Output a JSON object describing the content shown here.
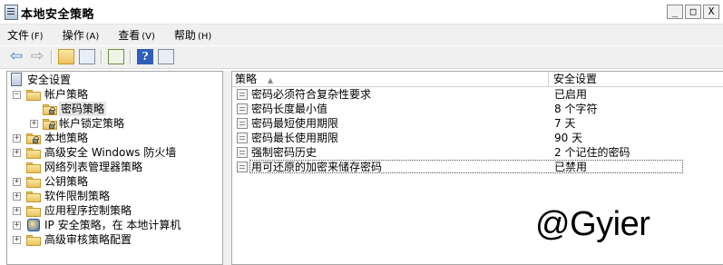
{
  "window": {
    "title": "本地安全策略",
    "minimize": "_",
    "maximize": "□",
    "close": "X"
  },
  "menu": [
    {
      "label": "文件",
      "accel": "(F)"
    },
    {
      "label": "操作",
      "accel": "(A)"
    },
    {
      "label": "查看",
      "accel": "(V)"
    },
    {
      "label": "帮助",
      "accel": "(H)"
    }
  ],
  "toolbar": {
    "help_glyph": "?",
    "back_glyph": "⇦",
    "forward_glyph": "⇨"
  },
  "tree": {
    "root": "安全设置",
    "items": [
      {
        "label": "帐户策略",
        "expander": "−",
        "icon": "folder-icon"
      },
      {
        "label": "密码策略",
        "icon": "folder-lock-icon",
        "selected": true
      },
      {
        "label": "帐户锁定策略",
        "expander": "+",
        "icon": "folder-lock-icon"
      },
      {
        "label": "本地策略",
        "expander": "+",
        "icon": "folder-lock-icon"
      },
      {
        "label": "高级安全 Windows 防火墙",
        "expander": "+",
        "icon": "folder-icon"
      },
      {
        "label": "网络列表管理器策略",
        "icon": "folder-icon"
      },
      {
        "label": "公钥策略",
        "expander": "+",
        "icon": "folder-icon"
      },
      {
        "label": "软件限制策略",
        "expander": "+",
        "icon": "folder-icon"
      },
      {
        "label": "应用程序控制策略",
        "expander": "+",
        "icon": "folder-icon"
      },
      {
        "label": "IP 安全策略，在 本地计算机",
        "expander": "+",
        "icon": "ip-security-icon"
      },
      {
        "label": "高级审核策略配置",
        "expander": "+",
        "icon": "folder-icon"
      }
    ]
  },
  "list": {
    "columns": {
      "policy": "策略",
      "setting": "安全设置",
      "sort_glyph": "▲"
    },
    "rows": [
      {
        "policy": "密码必须符合复杂性要求",
        "setting": "已启用"
      },
      {
        "policy": "密码长度最小值",
        "setting": "8 个字符"
      },
      {
        "policy": "密码最短使用期限",
        "setting": "7 天"
      },
      {
        "policy": "密码最长使用期限",
        "setting": "90 天"
      },
      {
        "policy": "强制密码历史",
        "setting": "2 个记住的密码"
      },
      {
        "policy": "用可还原的加密来储存密码",
        "setting": "已禁用"
      }
    ]
  },
  "watermark": "@Gyier"
}
